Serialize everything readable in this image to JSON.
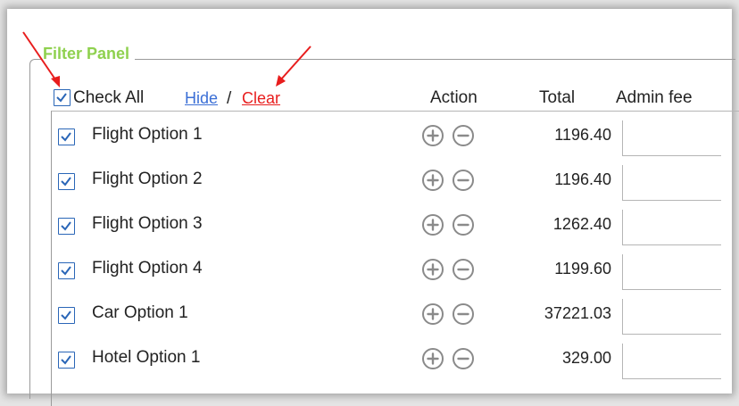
{
  "panel": {
    "legend": "Filter Panel"
  },
  "header": {
    "check_all_label": "Check All",
    "hide_link": "Hide",
    "separator": "/",
    "clear_link": "Clear",
    "action_label": "Action",
    "total_label": "Total",
    "admin_fee_label": "Admin fee"
  },
  "rows": [
    {
      "label": "Flight Option 1",
      "total": "1196.40",
      "checked": true
    },
    {
      "label": "Flight Option 2",
      "total": "1196.40",
      "checked": true
    },
    {
      "label": "Flight Option 3",
      "total": "1262.40",
      "checked": true
    },
    {
      "label": "Flight Option 4",
      "total": "1199.60",
      "checked": true
    },
    {
      "label": "Car Option 1",
      "total": "37221.03",
      "checked": true
    },
    {
      "label": "Hotel Option 1",
      "total": "329.00",
      "checked": true
    }
  ],
  "colors": {
    "legend": "#8fd14f",
    "checkbox": "#2a66b7",
    "hide_link": "#3b6fd6",
    "clear_link": "#e81d1d",
    "annotation_arrow": "#e81d1d"
  },
  "icons": [
    "plus-circle-icon",
    "minus-circle-icon",
    "check-icon",
    "red-arrow"
  ]
}
